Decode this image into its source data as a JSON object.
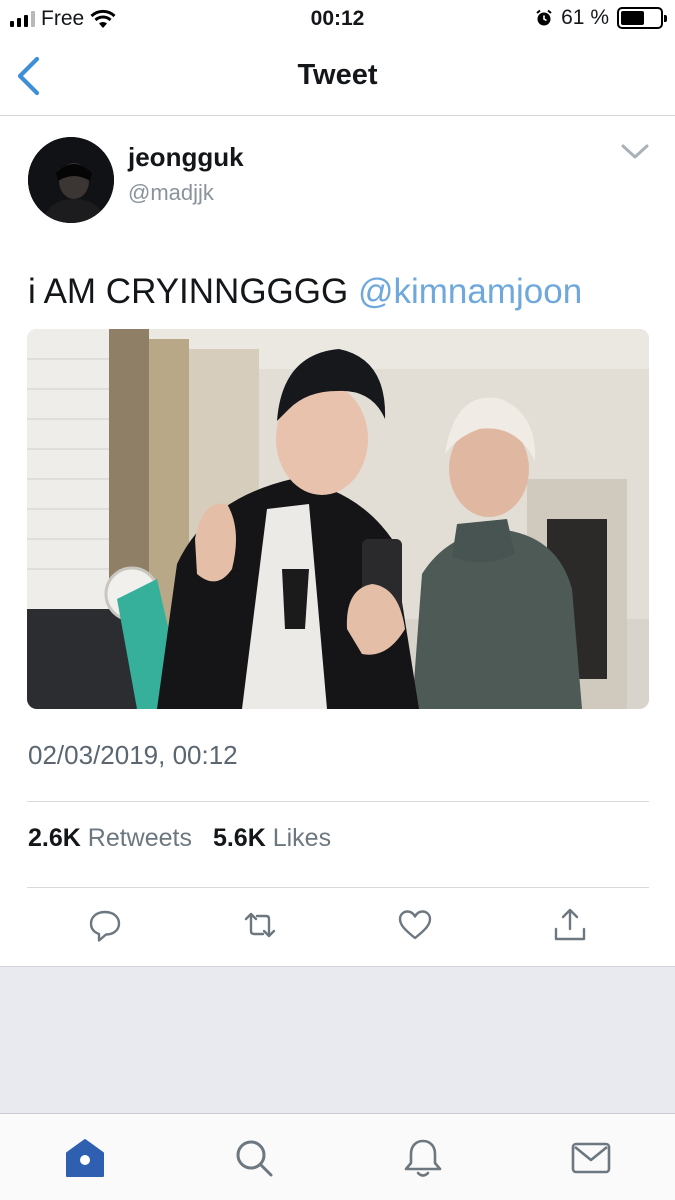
{
  "status_bar": {
    "carrier": "Free",
    "time": "00:12",
    "battery_percent": "61 %",
    "battery_level": 0.61
  },
  "nav": {
    "title": "Tweet",
    "back_icon": "chevron-left-icon"
  },
  "tweet": {
    "display_name": "jeongguk",
    "handle": "@madjjk",
    "text": "i AM CRYINNGGGG ",
    "mention": "@kimnamjoon",
    "timestamp": "02/03/2019, 00:12",
    "retweets_count": "2.6K",
    "retweets_label": "Retweets",
    "likes_count": "5.6K",
    "likes_label": "Likes"
  },
  "actions": [
    "reply-icon",
    "retweet-icon",
    "like-icon",
    "share-icon"
  ],
  "tabbar": [
    "home-icon",
    "search-icon",
    "notifications-icon",
    "messages-icon"
  ],
  "colors": {
    "accent": "#2f5fb0",
    "mention": "#6fa8dc",
    "secondary_text": "#8a939c",
    "action_icon": "#6c7780",
    "back_blue": "#3f8ed8"
  }
}
